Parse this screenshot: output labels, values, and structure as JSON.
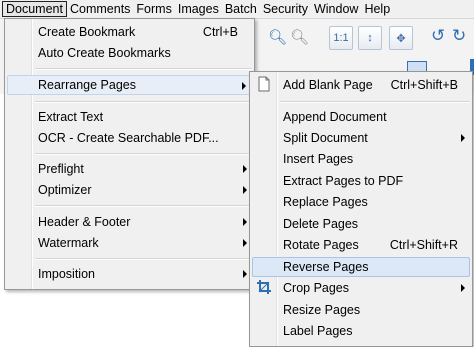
{
  "menubar": {
    "items": [
      "Document",
      "Comments",
      "Forms",
      "Images",
      "Batch",
      "Security",
      "Window",
      "Help"
    ]
  },
  "document_menu": {
    "items": [
      {
        "label": "Create Bookmark",
        "shortcut": "Ctrl+B"
      },
      {
        "label": "Auto Create Bookmarks"
      },
      {
        "label": "Rearrange Pages"
      },
      {
        "label": "Extract Text"
      },
      {
        "label": "OCR - Create Searchable PDF..."
      },
      {
        "label": "Preflight"
      },
      {
        "label": "Optimizer"
      },
      {
        "label": "Header & Footer"
      },
      {
        "label": "Watermark"
      },
      {
        "label": "Imposition"
      }
    ]
  },
  "rearrange_menu": {
    "items": [
      {
        "label": "Add Blank Page",
        "shortcut": "Ctrl+Shift+B"
      },
      {
        "label": "Append Document"
      },
      {
        "label": "Split Document"
      },
      {
        "label": "Insert Pages"
      },
      {
        "label": "Extract Pages to PDF"
      },
      {
        "label": "Replace Pages"
      },
      {
        "label": "Delete Pages"
      },
      {
        "label": "Rotate Pages",
        "shortcut": "Ctrl+Shift+R"
      },
      {
        "label": "Reverse Pages"
      },
      {
        "label": "Crop Pages"
      },
      {
        "label": "Resize Pages"
      },
      {
        "label": "Label Pages"
      }
    ]
  },
  "icons": {
    "add_blank_page": "blank-page-icon",
    "crop_pages": "crop-icon"
  },
  "colors": {
    "highlight": "#dce8f6",
    "highlight_border": "#a8c4e6",
    "crop_icon": "#2f6fb4"
  }
}
